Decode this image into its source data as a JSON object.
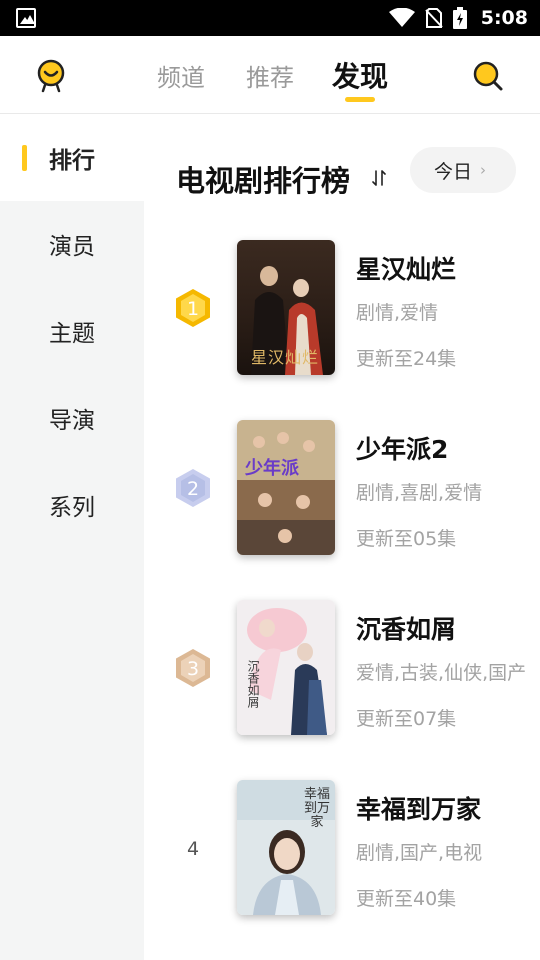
{
  "status_bar": {
    "time": "5:08"
  },
  "header": {
    "tabs": [
      {
        "label": "频道"
      },
      {
        "label": "推荐"
      },
      {
        "label": "发现"
      }
    ]
  },
  "sidebar": {
    "items": [
      {
        "label": "排行"
      },
      {
        "label": "演员"
      },
      {
        "label": "主题"
      },
      {
        "label": "导演"
      },
      {
        "label": "系列"
      }
    ]
  },
  "ranking": {
    "title": "电视剧排行榜",
    "period_label": "今日",
    "items": [
      {
        "rank": "1",
        "title": "星汉灿烂",
        "tags": "剧情,爱情",
        "update": "更新至24集",
        "poster_text": "星汉灿烂"
      },
      {
        "rank": "2",
        "title": "少年派2",
        "tags": "剧情,喜剧,爱情",
        "update": "更新至05集",
        "poster_text": "少年派"
      },
      {
        "rank": "3",
        "title": "沉香如屑",
        "tags": "爱情,古装,仙侠,国产",
        "update": "更新至07集",
        "poster_text": "沉香如屑"
      },
      {
        "rank": "4",
        "title": "幸福到万家",
        "tags": "剧情,国产,电视",
        "update": "更新至40集",
        "poster_text": "幸福到万家"
      }
    ]
  },
  "colors": {
    "accent": "#ffc81e",
    "gold_badge": "#f5b800",
    "silver_badge": "#b6bfe6",
    "bronze_badge": "#e6c8a8"
  }
}
